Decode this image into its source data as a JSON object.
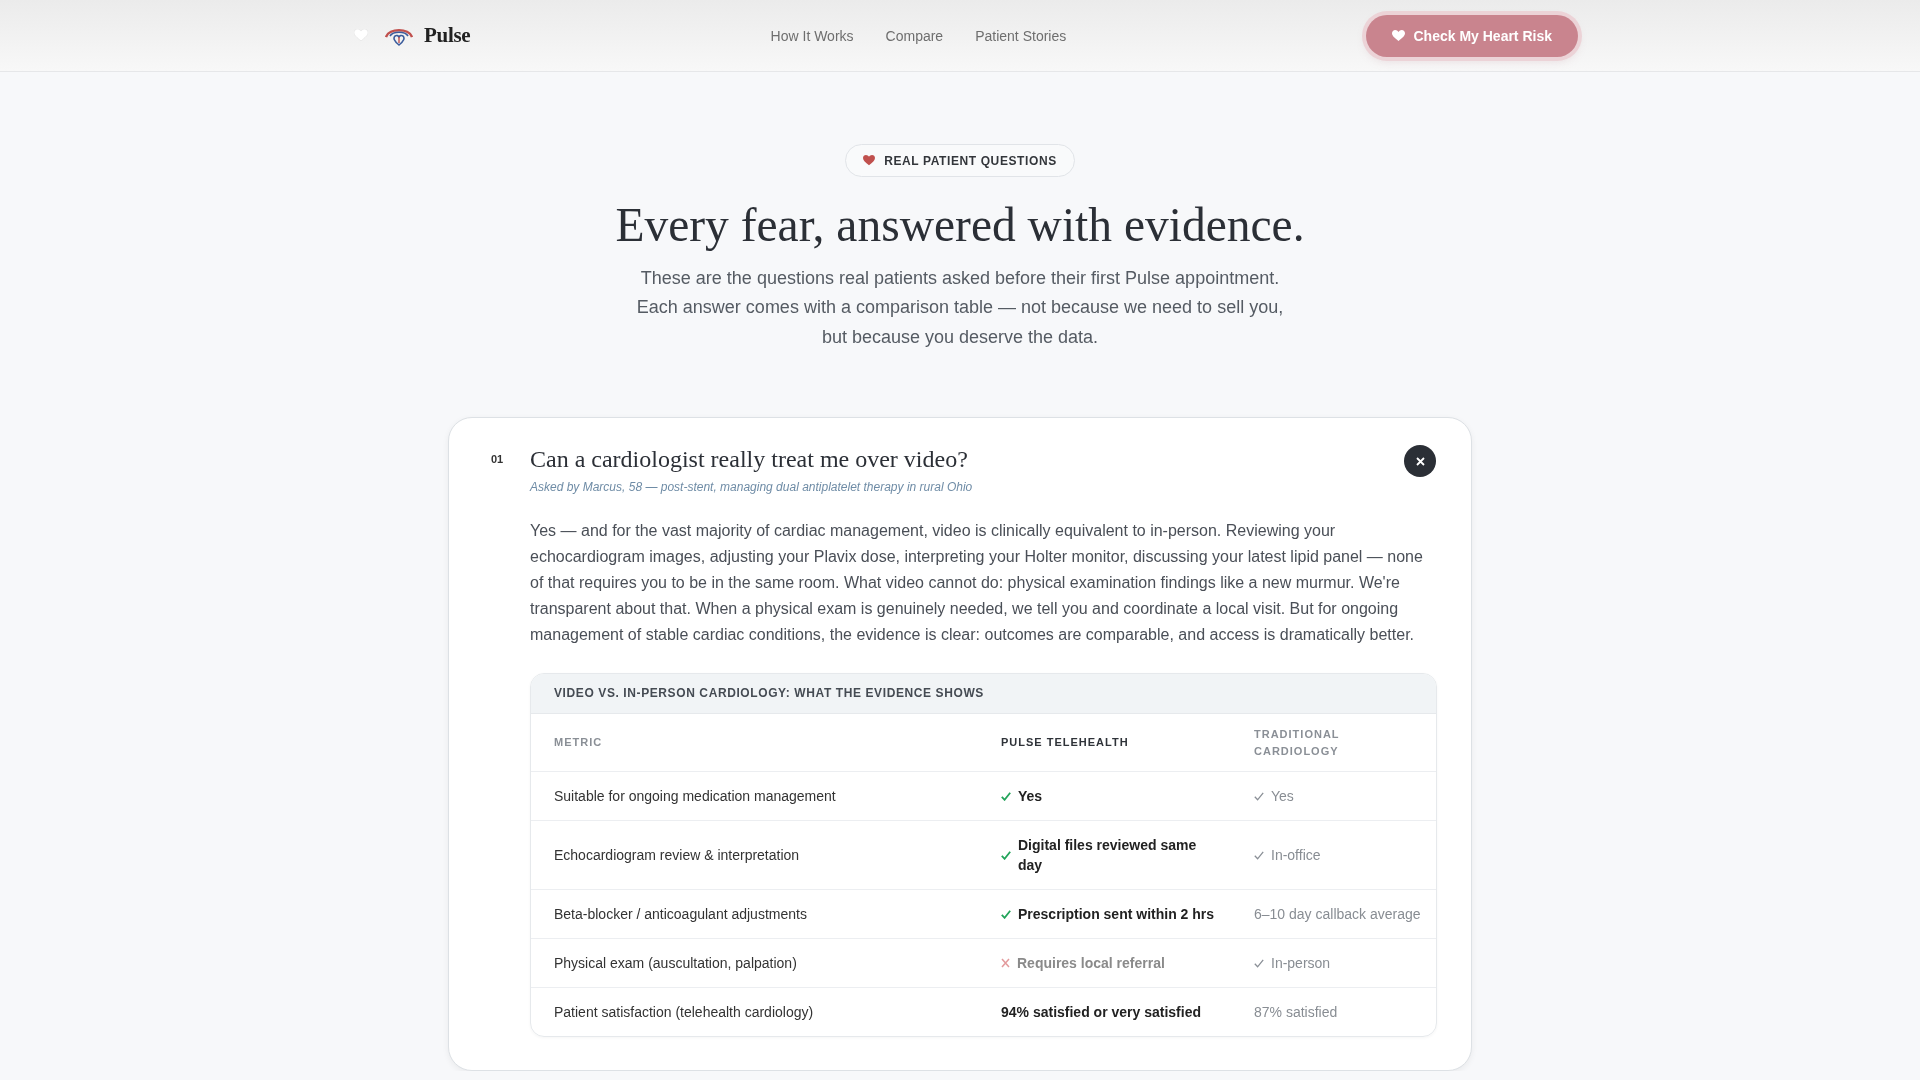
{
  "header": {
    "brand": "Pulse",
    "nav": [
      {
        "label": "How It Works"
      },
      {
        "label": "Compare"
      },
      {
        "label": "Patient Stories"
      }
    ],
    "cta": "Check My Heart Risk"
  },
  "hero": {
    "badge": "REAL PATIENT QUESTIONS",
    "title": "Every fear, answered with evidence.",
    "subtitle": "These are the questions real patients asked before their first Pulse appointment. Each answer comes with a comparison table — not because we need to sell you, but because you deserve the data."
  },
  "questions": [
    {
      "number": "01",
      "question": "Can a cardiologist really treat me over video?",
      "asked_by": "Asked by Marcus, 58 — post-stent, managing dual antiplatelet therapy in rural Ohio",
      "expanded": true,
      "answer": "Yes — and for the vast majority of cardiac management, video is clinically equivalent to in-person. Reviewing your echocardiogram images, adjusting your Plavix dose, interpreting your Holter monitor, discussing your latest lipid panel — none of that requires you to be in the same room. What video cannot do: physical examination findings like a new murmur. We're transparent about that. When a physical exam is genuinely needed, we tell you and coordinate a local visit. But for ongoing management of stable cardiac conditions, the evidence is clear: outcomes are comparable, and access is dramatically better.",
      "table": {
        "title": "VIDEO VS. IN-PERSON CARDIOLOGY: WHAT THE EVIDENCE SHOWS",
        "columns": [
          "METRIC",
          "PULSE TELEHEALTH",
          "TRADITIONAL CARDIOLOGY"
        ],
        "rows": [
          {
            "metric": "Suitable for ongoing medication management",
            "pulse": {
              "kind": "check",
              "text": "Yes"
            },
            "traditional": {
              "kind": "check",
              "text": "Yes"
            }
          },
          {
            "metric": "Echocardiogram review & interpretation",
            "pulse": {
              "kind": "check",
              "text": "Digital files reviewed same day"
            },
            "traditional": {
              "kind": "check",
              "text": "In-office"
            }
          },
          {
            "metric": "Beta-blocker / anticoagulant adjustments",
            "pulse": {
              "kind": "check",
              "text": "Prescription sent within 2 hrs"
            },
            "traditional": {
              "kind": "plain",
              "text": "6–10 day callback average"
            }
          },
          {
            "metric": "Physical exam (auscultation, palpation)",
            "pulse": {
              "kind": "cross",
              "text": "Requires local referral"
            },
            "traditional": {
              "kind": "check",
              "text": "In-person"
            }
          },
          {
            "metric": "Patient satisfaction (telehealth cardiology)",
            "pulse": {
              "kind": "plain",
              "text": "94% satisfied or very satisfied"
            },
            "traditional": {
              "kind": "plain",
              "text": "87% satisfied"
            }
          }
        ]
      }
    }
  ]
}
